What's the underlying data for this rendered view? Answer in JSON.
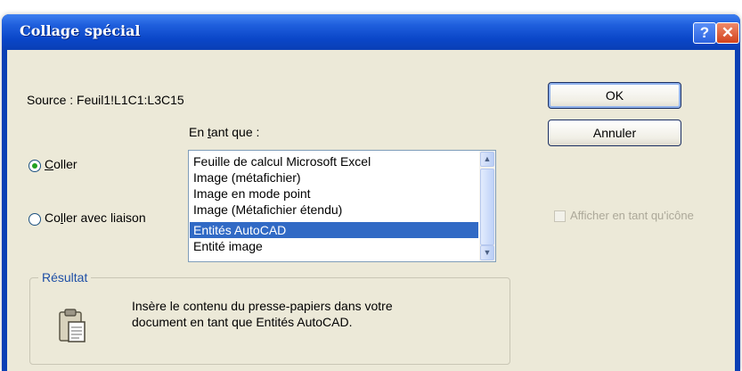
{
  "dialog": {
    "title": "Collage spécial",
    "help_label": "?",
    "close_label": "✕"
  },
  "source": {
    "label": "Source :",
    "value": "Feuil1!L1C1:L3C15"
  },
  "buttons": {
    "ok": "OK",
    "cancel": "Annuler"
  },
  "as_label": {
    "pre": "En ",
    "mnemonic": "t",
    "post": "ant que :"
  },
  "radio_paste": {
    "mnemonic": "C",
    "rest": "oller",
    "checked": true
  },
  "radio_paste_link": {
    "pre": "Co",
    "mnemonic": "l",
    "post": "ler avec liaison",
    "checked": false
  },
  "list": {
    "items": [
      "Feuille de calcul Microsoft Excel",
      "Image (métafichier)",
      "Image en mode point",
      "Image (Métafichier étendu)",
      "Entités AutoCAD",
      "Entité image"
    ],
    "selected": "Entités AutoCAD"
  },
  "display_as_icon": {
    "label": "Afficher en tant qu'icône",
    "enabled": false,
    "checked": false
  },
  "result": {
    "legend": "Résultat",
    "line1": "Insère le contenu du presse-papiers dans votre",
    "line2": "document en tant que Entités AutoCAD."
  },
  "icons": {
    "help": "help-icon",
    "close": "close-icon",
    "clipboard": "clipboard-icon",
    "scroll_up": "scroll-up-arrow-icon",
    "scroll_down": "scroll-down-arrow-icon"
  },
  "colors": {
    "titlebar": "#0a46c8",
    "client": "#ece9d8",
    "selection": "#316ac5",
    "close_button": "#d2421c",
    "legend_text": "#1e4fa6"
  }
}
